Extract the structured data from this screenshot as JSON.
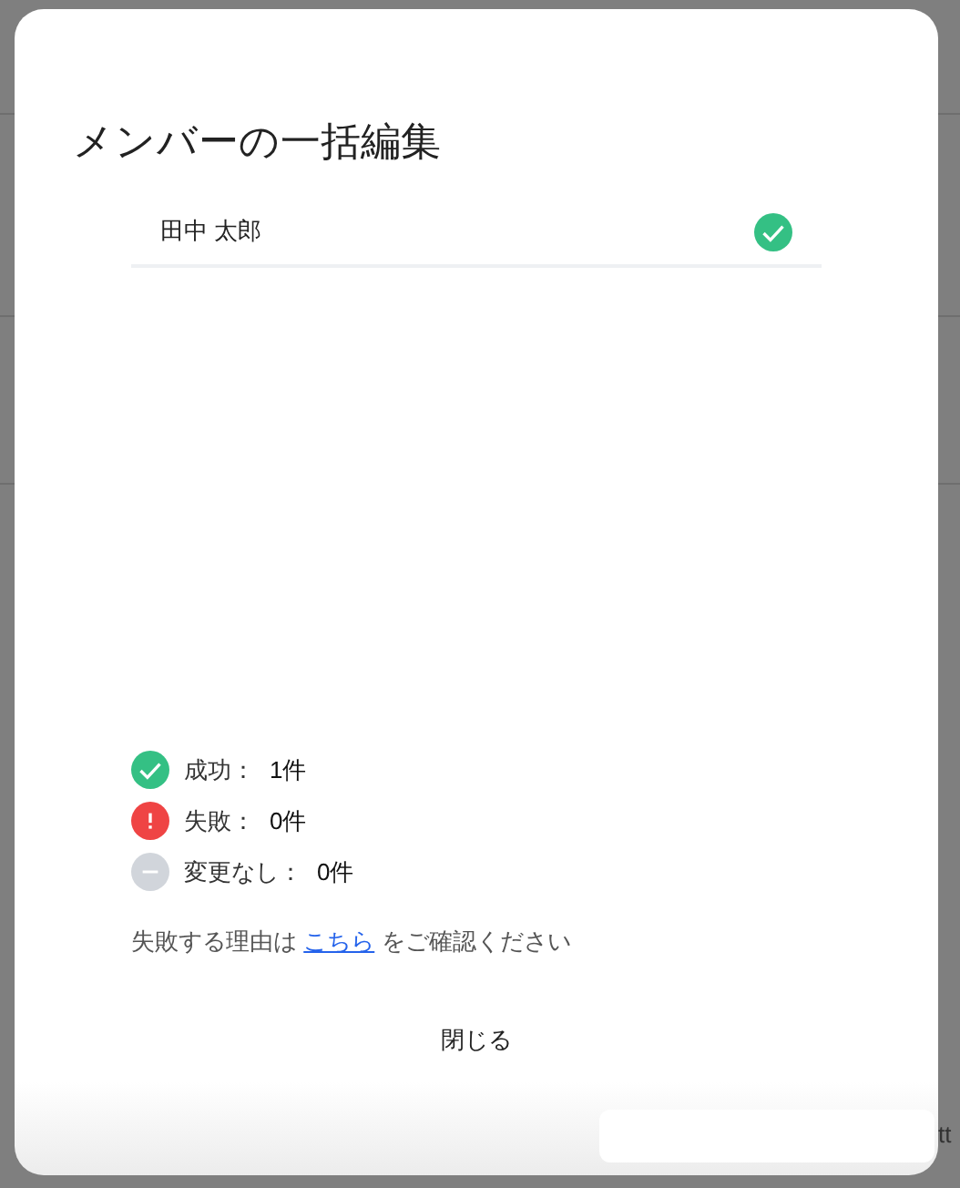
{
  "dialog": {
    "title": "メンバーの一括編集",
    "members": [
      {
        "name": "田中 太郎",
        "kind": "success"
      }
    ],
    "summary": [
      {
        "kind": "success",
        "label": "成功：",
        "count": "1件"
      },
      {
        "kind": "failure",
        "label": "失敗：",
        "count": "0件"
      },
      {
        "kind": "unchanged",
        "label": "変更なし：",
        "count": "0件"
      }
    ],
    "note": {
      "before": "失敗する理由は",
      "link": "こちら",
      "after": "をご確認ください"
    },
    "close_button": "閉じる"
  },
  "background_fragment": "tt"
}
